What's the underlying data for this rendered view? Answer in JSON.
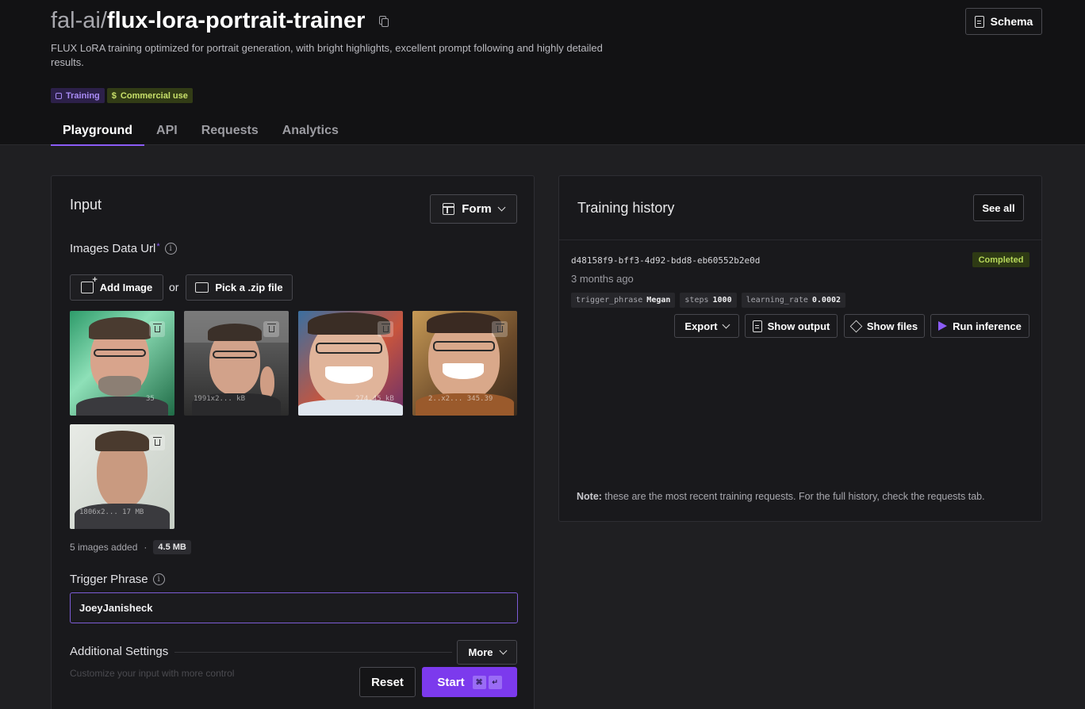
{
  "header": {
    "org": "fal-ai/",
    "model": "flux-lora-portrait-trainer",
    "description": "FLUX LoRA training optimized for portrait generation, with bright highlights, excellent prompt following and highly detailed results.",
    "badges": {
      "training": "Training",
      "commercial": "Commercial use"
    },
    "schema_label": "Schema",
    "tabs": [
      "Playground",
      "API",
      "Requests",
      "Analytics"
    ],
    "active_tab": "Playground"
  },
  "input": {
    "title": "Input",
    "mode_label": "Form",
    "images_label": "Images Data Url",
    "images_required": "*",
    "add_image_label": "Add Image",
    "or_label": "or",
    "pick_zip_label": "Pick a .zip file",
    "thumbnails": [
      {
        "meta": "35"
      },
      {
        "meta": "1991x2... kB"
      },
      {
        "meta": "274.45 kB"
      },
      {
        "meta": "2..x2... 345.39"
      },
      {
        "meta": "1806x2... 17 MB"
      }
    ],
    "count_text": "5 images added",
    "size_text": "4.5 MB",
    "trigger_label": "Trigger Phrase",
    "trigger_value": "JoeyJanisheck",
    "additional_label": "Additional Settings",
    "more_label": "More",
    "hint_text": "Customize your input with more control",
    "reset_label": "Reset",
    "start_label": "Start",
    "kbd_cmd": "⌘",
    "kbd_enter": "↵"
  },
  "history": {
    "title": "Training history",
    "see_all_label": "See all",
    "request_id": "d48158f9-bff3-4d92-bdd8-eb60552b2e0d",
    "status": "Completed",
    "time_ago": "3 months ago",
    "params": [
      {
        "key": "trigger_phrase",
        "value": "Megan"
      },
      {
        "key": "steps",
        "value": "1000"
      },
      {
        "key": "learning_rate",
        "value": "0.0002"
      }
    ],
    "export_label": "Export",
    "show_output_label": "Show output",
    "show_files_label": "Show files",
    "run_inference_label": "Run inference",
    "note_bold": "Note:",
    "note_text": " these are the most recent training requests. For the full history, check the requests tab."
  }
}
